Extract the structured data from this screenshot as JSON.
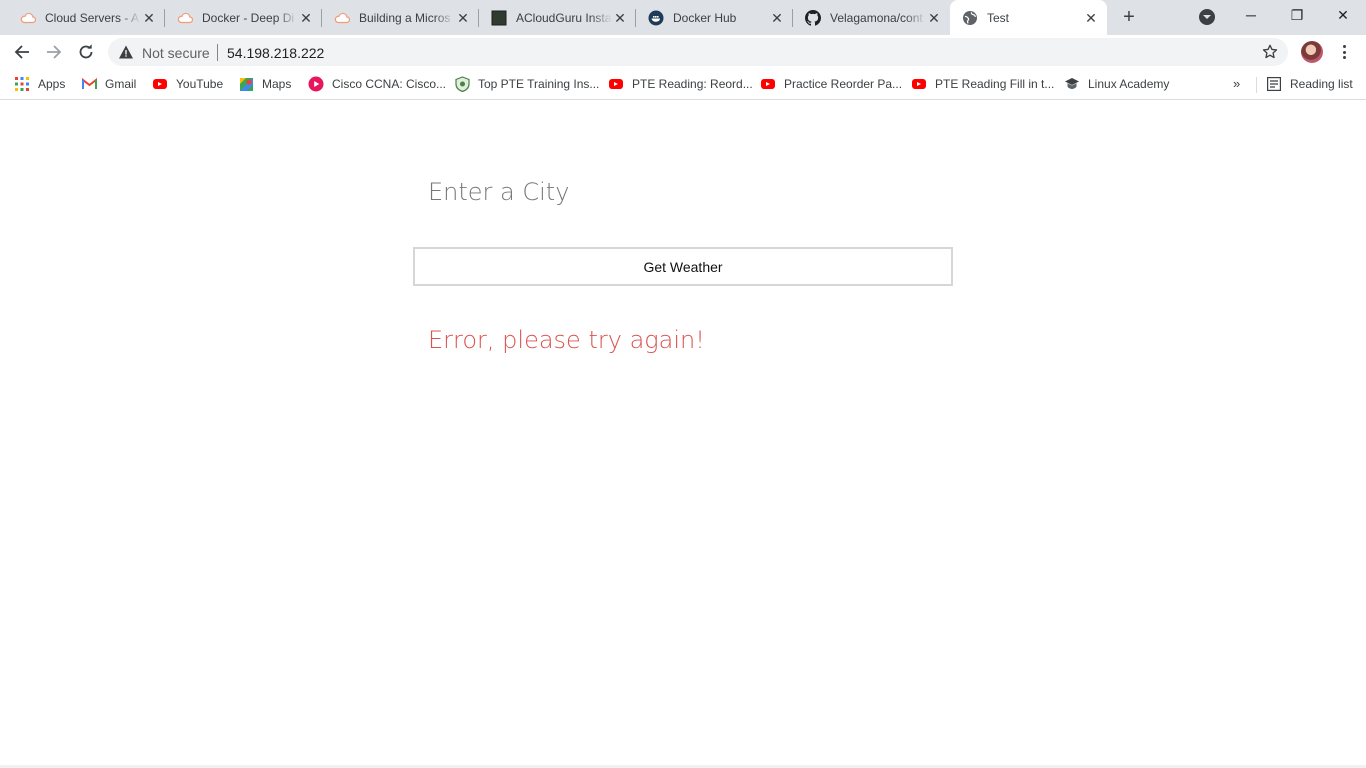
{
  "browser": {
    "tabs": [
      {
        "title": "Cloud Servers - A",
        "icon": "cloud-icon"
      },
      {
        "title": "Docker - Deep Di",
        "icon": "cloud-icon"
      },
      {
        "title": "Building a Micros",
        "icon": "cloud-icon"
      },
      {
        "title": "ACloudGuru Insta",
        "icon": "terminal-icon"
      },
      {
        "title": "Docker Hub",
        "icon": "docker-icon"
      },
      {
        "title": "Velagamona/cont",
        "icon": "github-icon"
      },
      {
        "title": "Test",
        "icon": "globe-icon"
      }
    ],
    "tab_close_glyph": "✕",
    "new_tab_glyph": "+",
    "window_controls": {
      "minimize": "─",
      "restore": "❐",
      "close": "✕"
    },
    "omnibox": {
      "security_label": "Not secure",
      "url": "54.198.218.222"
    },
    "bookmarks": [
      {
        "label": "Apps",
        "icon": "apps-grid-icon"
      },
      {
        "label": "Gmail",
        "icon": "gmail-icon"
      },
      {
        "label": "YouTube",
        "icon": "youtube-icon"
      },
      {
        "label": "Maps",
        "icon": "maps-icon"
      },
      {
        "label": "Cisco CCNA: Cisco...",
        "icon": "podcast-icon"
      },
      {
        "label": "Top PTE Training Ins...",
        "icon": "shield-icon"
      },
      {
        "label": "PTE Reading: Reord...",
        "icon": "youtube-icon"
      },
      {
        "label": "Practice Reorder Pa...",
        "icon": "youtube-icon"
      },
      {
        "label": "PTE Reading Fill in t...",
        "icon": "youtube-icon"
      },
      {
        "label": "Linux Academy",
        "icon": "graduation-cap-icon"
      }
    ],
    "overflow_glyph": "»",
    "reading_list_label": "Reading list"
  },
  "page": {
    "city_placeholder": "Enter a City",
    "city_value": "",
    "button_label": "Get Weather",
    "error_message": "Error, please try again!"
  },
  "colors": {
    "error": "#d9534f",
    "tab_strip": "#dee1e6",
    "omnibox": "#f1f3f4"
  }
}
